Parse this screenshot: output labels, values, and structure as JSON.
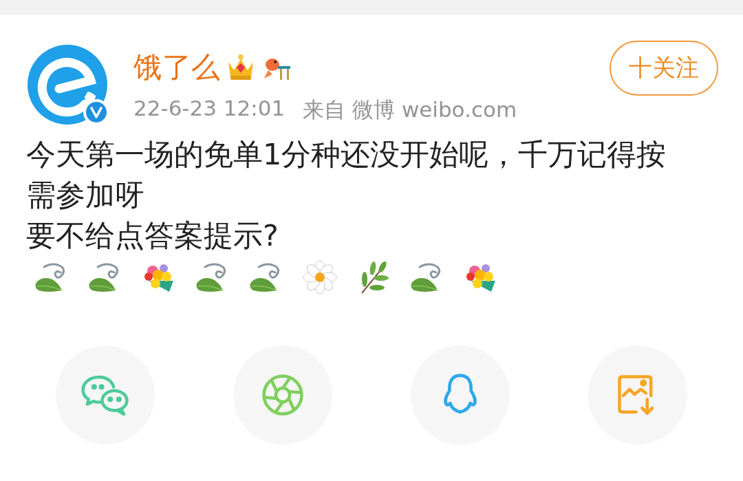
{
  "post": {
    "author": "饿了么",
    "verified": true,
    "badges": [
      {
        "kind": "crown"
      },
      {
        "kind": "fish"
      }
    ],
    "time": "22-6-23 12:01",
    "source": "来自 微博 weibo.com",
    "follow_button": "十关注",
    "paragraphs": [
      "今天第一场的免单1分种还没开始呢，千万记得按需参加呀",
      "要不给点答案提示?"
    ],
    "emoticons": [
      {
        "kind": "leaf"
      },
      {
        "kind": "leaf"
      },
      {
        "kind": "bouquet"
      },
      {
        "kind": "leaf"
      },
      {
        "kind": "leaf"
      },
      {
        "kind": "daisy"
      },
      {
        "kind": "branch"
      },
      {
        "kind": "leaf"
      },
      {
        "kind": "bouquet"
      }
    ]
  },
  "share": [
    {
      "kind": "wechat"
    },
    {
      "kind": "moments"
    },
    {
      "kind": "qq"
    },
    {
      "kind": "save-image"
    }
  ]
}
